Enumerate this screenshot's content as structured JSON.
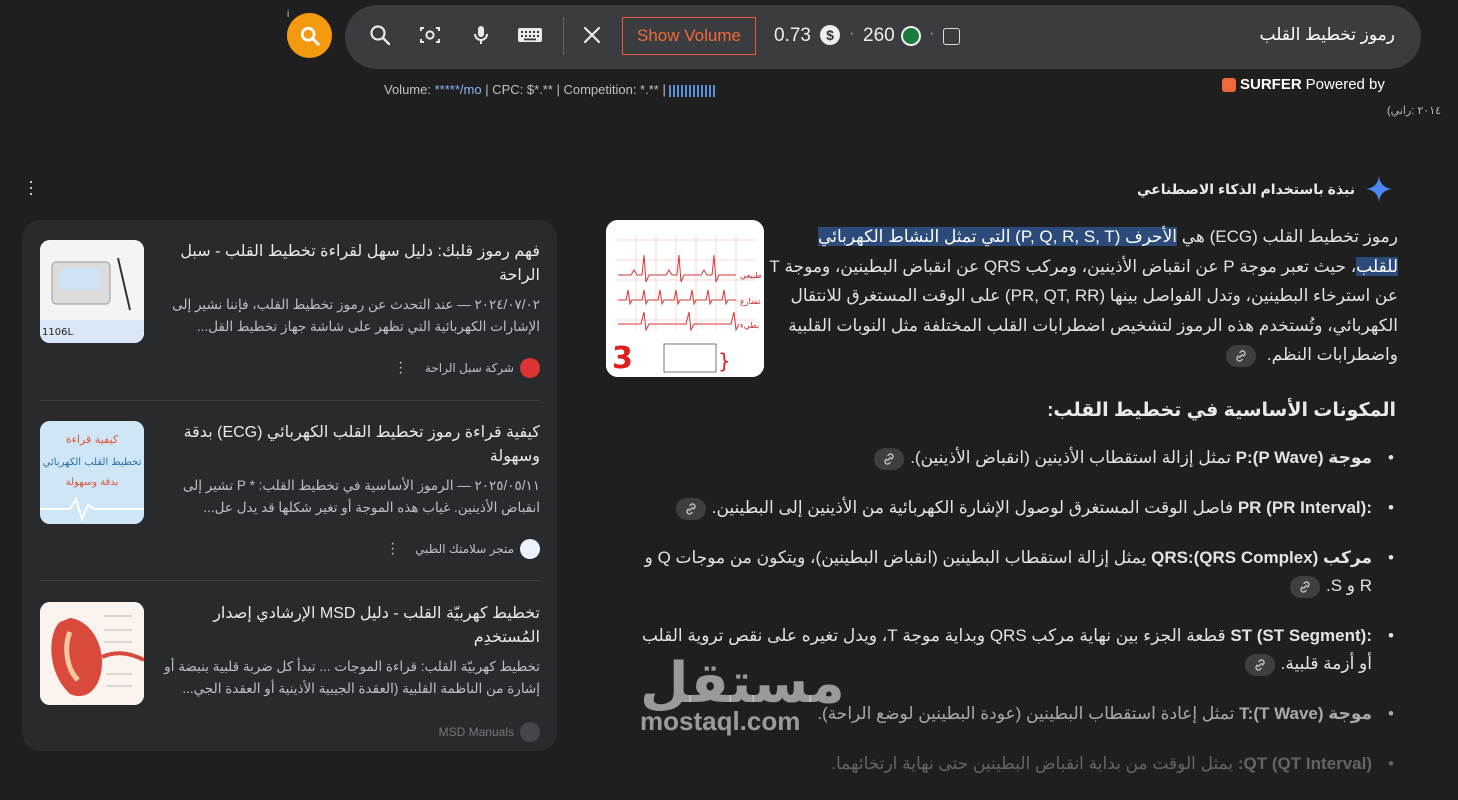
{
  "search": {
    "info_mark": "i",
    "show_volume_label": "Show Volume",
    "cpc_value": "0.73",
    "volume_value": "260",
    "query": "رموز تخطيط القلب",
    "dot": "·"
  },
  "keyword_stats": {
    "volume_label": "Volume:",
    "volume_value": "*****/mo",
    "cpc": " | CPC: $*.** | Competition: *.** | "
  },
  "surfer": {
    "brand": "SURFER",
    "powered_by": "Powered by"
  },
  "partial_date": "(٢٠١٤ :راني",
  "ai_overview": {
    "heading": "نبذة باستخدام الذكاء الاصطناعي",
    "intro_before": "رموز تخطيط القلب (ECG) هي ",
    "intro_highlight": "الأحرف (P, Q, R, S, T) التي تمثل النشاط الكهربائي للقلب",
    "intro_after": "، حيث تعبر موجة P عن انقباض الأذينين، ومركب QRS عن انقباض البطينين، وموجة T عن استرخاء البطينين، وتدل الفواصل بينها (PR, QT, RR) على الوقت المستغرق للانتقال الكهربائي، وتُستخدم هذه الرموز لتشخيص اضطرابات القلب المختلفة مثل النوبات القلبية واضطرابات النظم.",
    "components_heading": "المكونات الأساسية في تخطيط القلب:",
    "items": [
      {
        "bold": "موجة P:(P Wave)",
        "text": " تمثل إزالة استقطاب الأذينين (انقباض الأذينين)."
      },
      {
        "bold": ":PR (PR Interval)",
        "text": " فاصل الوقت المستغرق لوصول الإشارة الكهربائية من الأذينين إلى البطينين."
      },
      {
        "bold": "مركب QRS:(QRS Complex)",
        "text": " يمثل إزالة استقطاب البطينين (انقباض البطينين)، ويتكون من موجات Q و R و S."
      },
      {
        "bold": ":ST (ST Segment)",
        "text": " قطعة الجزء بين نهاية مركب QRS وبداية موجة T، ويدل تغيره على نقص تروية القلب أو أزمة قلبية."
      },
      {
        "bold": "موجة T:(T Wave)",
        "text": " تمثل إعادة استقطاب البطينين (عودة البطينين لوضع الراحة)."
      },
      {
        "bold": "QT (QT Interval):",
        "text": " يمثل الوقت من بداية انقباض البطينين حتى نهاية ارتخائهما."
      }
    ],
    "thumb_number": "3",
    "thumb_labels": [
      "طبيعي",
      "تسارع",
      "بطيء"
    ]
  },
  "sources": [
    {
      "title": "فهم رموز قلبك: دليل سهل لقراءة تخطيط القلب - سبل الراحة",
      "date": "٢٠٢٤/٠٧/٠٢",
      "snippet": " — عند التحدث عن رموز تخطيط القلب، فإننا نشير إلى الإشارات الكهربائية التي تظهر على شاشة جهاز تخطيط القل...",
      "source": "شركة سبل الراحة"
    },
    {
      "title": "كيفية قراءة رموز تخطيط القلب الكهربائي (ECG) بدقة وسهولة",
      "date": "٢٠٢٥/٠٥/١١",
      "snippet": " — الرموز الأساسية في تخطيط القلب: * P تشير إلى انقباض الأذينين. غياب هذه الموجة أو تغير شكلها قد يدل عل...",
      "source": "متجر سلامتك الطبي"
    },
    {
      "title": "تخطيط كهربيّة القلب - دليل MSD الإرشادي إصدار المُستخدِم",
      "date": "",
      "snippet": "تخطيط كهربيّة القلب: قراءة الموجات ... تبدأ كل ضربة قلبية بنبضة أو إشارة من الناظمة القلبية (العقدة الجيبية الأذينية أو العقدة الجي...",
      "source": "MSD Manuals"
    }
  ],
  "card_thumb_texts": [
    "1106L",
    "كيفية قراءة",
    "تخطيط القلب الكهربائي",
    "بدقة وسهولة"
  ],
  "watermark": {
    "arabic": "مستقل",
    "latin": "mostaql.com"
  },
  "colors": {
    "accent_orange": "#f59a0f",
    "show_volume_border": "#e8573c",
    "highlight": "#2c4a7a",
    "link_blue": "#8ab4f8"
  }
}
